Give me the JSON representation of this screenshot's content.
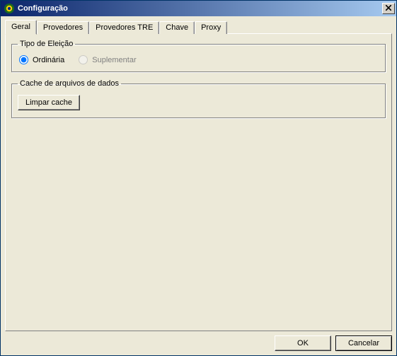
{
  "window": {
    "title": "Configuração"
  },
  "tabs": [
    {
      "label": "Geral"
    },
    {
      "label": "Provedores"
    },
    {
      "label": "Provedores TRE"
    },
    {
      "label": "Chave"
    },
    {
      "label": "Proxy"
    }
  ],
  "group_tipo": {
    "legend": "Tipo de Eleição",
    "radios": {
      "ordinaria": "Ordinária",
      "suplementar": "Suplementar"
    }
  },
  "group_cache": {
    "legend": "Cache de arquivos de dados",
    "button": "Limpar cache"
  },
  "footer": {
    "ok": "OK",
    "cancel": "Cancelar"
  }
}
